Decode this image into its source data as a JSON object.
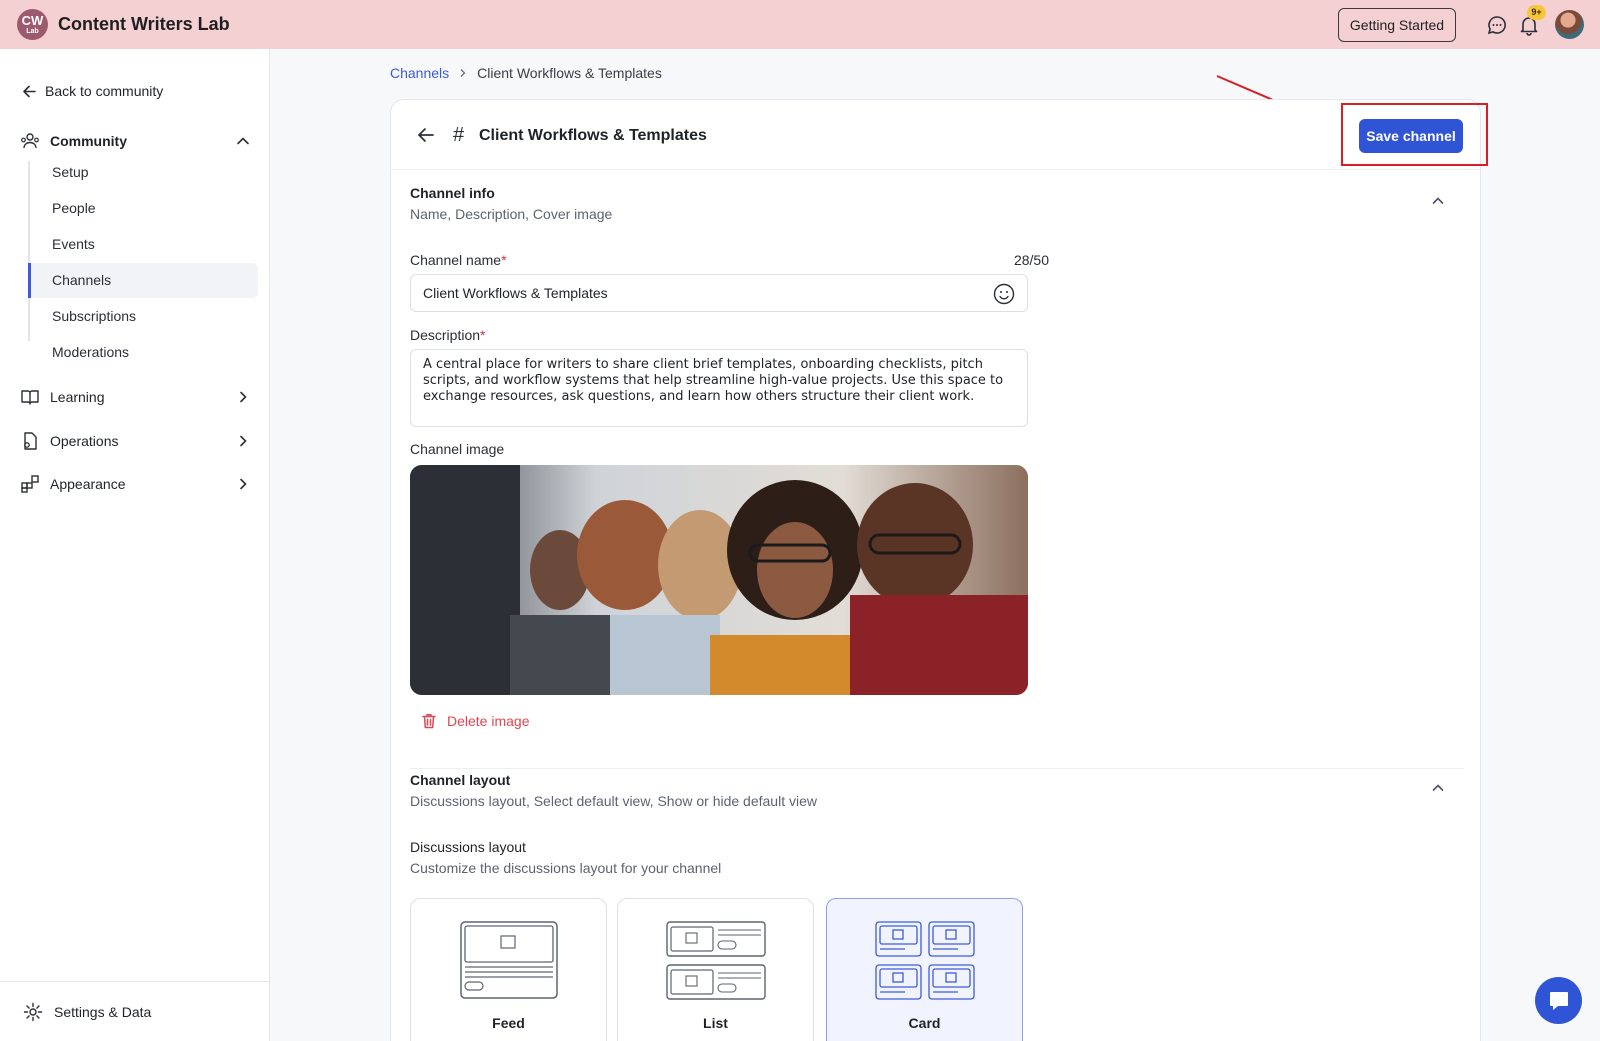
{
  "app": {
    "logo_main": "CW",
    "logo_sub": "Lab",
    "title": "Content Writers Lab",
    "getting_started": "Getting Started",
    "notification_count": "9+"
  },
  "sidebar": {
    "back": "Back to community",
    "community": "Community",
    "sub_items": [
      "Setup",
      "People",
      "Events",
      "Channels",
      "Subscriptions",
      "Moderations"
    ],
    "active_item": "Channels",
    "groups": [
      "Learning",
      "Operations",
      "Appearance"
    ],
    "settings": "Settings & Data"
  },
  "breadcrumb": {
    "parent": "Channels",
    "current": "Client Workflows & Templates"
  },
  "card": {
    "title": "Client Workflows & Templates",
    "save_label": "Save channel"
  },
  "channel_info": {
    "title": "Channel info",
    "subtitle": "Name, Description, Cover image",
    "name_label": "Channel name",
    "name_counter": "28/50",
    "name_value": "Client Workflows & Templates",
    "desc_label": "Description",
    "desc_value": "A central place for writers to share client brief templates, onboarding checklists, pitch scripts, and workflow systems that help streamline high-value projects. Use this space to exchange resources, ask questions, and learn how others structure their client work.",
    "image_label": "Channel image",
    "delete_image": "Delete image"
  },
  "channel_layout": {
    "title": "Channel layout",
    "subtitle": "Discussions layout, Select default view, Show or hide default view",
    "discussions_title": "Discussions layout",
    "discussions_sub": "Customize the discussions layout for your channel",
    "options": [
      "Feed",
      "List",
      "Card"
    ],
    "selected": "Card"
  },
  "colors": {
    "topbar": "#f5d0d3",
    "accent": "#2f54d6",
    "danger": "#e0464f",
    "annotation": "#d91f26"
  }
}
